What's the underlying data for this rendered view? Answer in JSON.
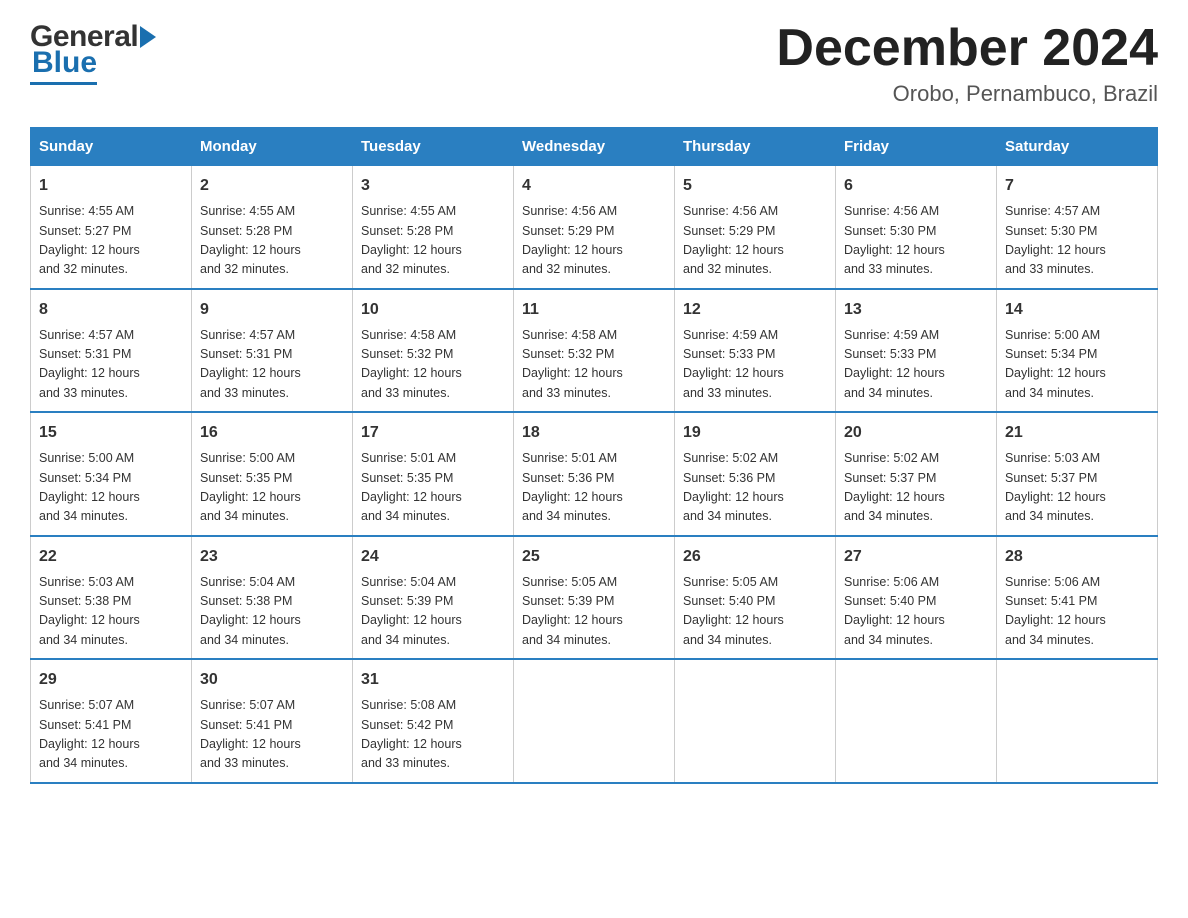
{
  "logo": {
    "general": "General",
    "blue": "Blue"
  },
  "title": "December 2024",
  "subtitle": "Orobo, Pernambuco, Brazil",
  "headers": [
    "Sunday",
    "Monday",
    "Tuesday",
    "Wednesday",
    "Thursday",
    "Friday",
    "Saturday"
  ],
  "weeks": [
    [
      {
        "day": "1",
        "sunrise": "4:55 AM",
        "sunset": "5:27 PM",
        "daylight": "12 hours and 32 minutes."
      },
      {
        "day": "2",
        "sunrise": "4:55 AM",
        "sunset": "5:28 PM",
        "daylight": "12 hours and 32 minutes."
      },
      {
        "day": "3",
        "sunrise": "4:55 AM",
        "sunset": "5:28 PM",
        "daylight": "12 hours and 32 minutes."
      },
      {
        "day": "4",
        "sunrise": "4:56 AM",
        "sunset": "5:29 PM",
        "daylight": "12 hours and 32 minutes."
      },
      {
        "day": "5",
        "sunrise": "4:56 AM",
        "sunset": "5:29 PM",
        "daylight": "12 hours and 32 minutes."
      },
      {
        "day": "6",
        "sunrise": "4:56 AM",
        "sunset": "5:30 PM",
        "daylight": "12 hours and 33 minutes."
      },
      {
        "day": "7",
        "sunrise": "4:57 AM",
        "sunset": "5:30 PM",
        "daylight": "12 hours and 33 minutes."
      }
    ],
    [
      {
        "day": "8",
        "sunrise": "4:57 AM",
        "sunset": "5:31 PM",
        "daylight": "12 hours and 33 minutes."
      },
      {
        "day": "9",
        "sunrise": "4:57 AM",
        "sunset": "5:31 PM",
        "daylight": "12 hours and 33 minutes."
      },
      {
        "day": "10",
        "sunrise": "4:58 AM",
        "sunset": "5:32 PM",
        "daylight": "12 hours and 33 minutes."
      },
      {
        "day": "11",
        "sunrise": "4:58 AM",
        "sunset": "5:32 PM",
        "daylight": "12 hours and 33 minutes."
      },
      {
        "day": "12",
        "sunrise": "4:59 AM",
        "sunset": "5:33 PM",
        "daylight": "12 hours and 33 minutes."
      },
      {
        "day": "13",
        "sunrise": "4:59 AM",
        "sunset": "5:33 PM",
        "daylight": "12 hours and 34 minutes."
      },
      {
        "day": "14",
        "sunrise": "5:00 AM",
        "sunset": "5:34 PM",
        "daylight": "12 hours and 34 minutes."
      }
    ],
    [
      {
        "day": "15",
        "sunrise": "5:00 AM",
        "sunset": "5:34 PM",
        "daylight": "12 hours and 34 minutes."
      },
      {
        "day": "16",
        "sunrise": "5:00 AM",
        "sunset": "5:35 PM",
        "daylight": "12 hours and 34 minutes."
      },
      {
        "day": "17",
        "sunrise": "5:01 AM",
        "sunset": "5:35 PM",
        "daylight": "12 hours and 34 minutes."
      },
      {
        "day": "18",
        "sunrise": "5:01 AM",
        "sunset": "5:36 PM",
        "daylight": "12 hours and 34 minutes."
      },
      {
        "day": "19",
        "sunrise": "5:02 AM",
        "sunset": "5:36 PM",
        "daylight": "12 hours and 34 minutes."
      },
      {
        "day": "20",
        "sunrise": "5:02 AM",
        "sunset": "5:37 PM",
        "daylight": "12 hours and 34 minutes."
      },
      {
        "day": "21",
        "sunrise": "5:03 AM",
        "sunset": "5:37 PM",
        "daylight": "12 hours and 34 minutes."
      }
    ],
    [
      {
        "day": "22",
        "sunrise": "5:03 AM",
        "sunset": "5:38 PM",
        "daylight": "12 hours and 34 minutes."
      },
      {
        "day": "23",
        "sunrise": "5:04 AM",
        "sunset": "5:38 PM",
        "daylight": "12 hours and 34 minutes."
      },
      {
        "day": "24",
        "sunrise": "5:04 AM",
        "sunset": "5:39 PM",
        "daylight": "12 hours and 34 minutes."
      },
      {
        "day": "25",
        "sunrise": "5:05 AM",
        "sunset": "5:39 PM",
        "daylight": "12 hours and 34 minutes."
      },
      {
        "day": "26",
        "sunrise": "5:05 AM",
        "sunset": "5:40 PM",
        "daylight": "12 hours and 34 minutes."
      },
      {
        "day": "27",
        "sunrise": "5:06 AM",
        "sunset": "5:40 PM",
        "daylight": "12 hours and 34 minutes."
      },
      {
        "day": "28",
        "sunrise": "5:06 AM",
        "sunset": "5:41 PM",
        "daylight": "12 hours and 34 minutes."
      }
    ],
    [
      {
        "day": "29",
        "sunrise": "5:07 AM",
        "sunset": "5:41 PM",
        "daylight": "12 hours and 34 minutes."
      },
      {
        "day": "30",
        "sunrise": "5:07 AM",
        "sunset": "5:41 PM",
        "daylight": "12 hours and 33 minutes."
      },
      {
        "day": "31",
        "sunrise": "5:08 AM",
        "sunset": "5:42 PM",
        "daylight": "12 hours and 33 minutes."
      },
      null,
      null,
      null,
      null
    ]
  ],
  "cell_labels": {
    "sunrise": "Sunrise:",
    "sunset": "Sunset:",
    "daylight": "Daylight:"
  }
}
